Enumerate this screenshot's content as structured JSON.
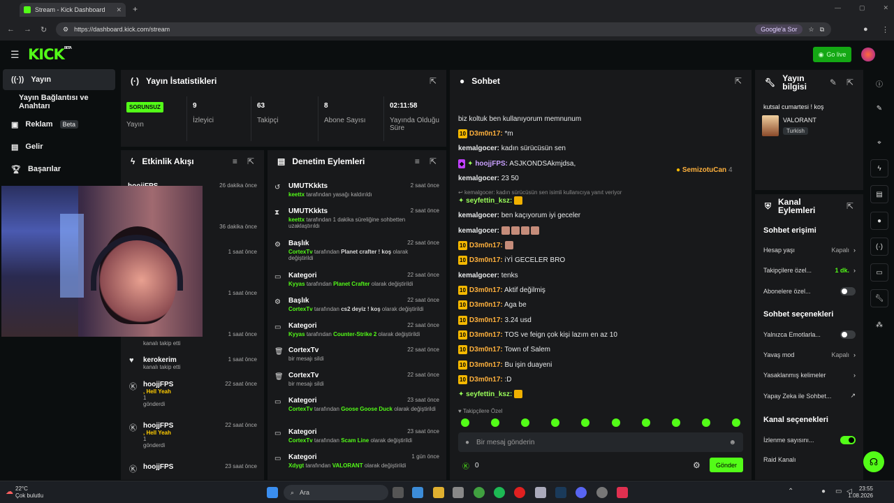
{
  "browser": {
    "tab_title": "Stream - Kick Dashboard",
    "url": "https://dashboard.kick.com/stream",
    "ask_google": "Google'a Sor"
  },
  "header": {
    "logo": "KICK",
    "beta": "BETA",
    "go_live": "Go live"
  },
  "sidebar": {
    "items": [
      {
        "label": "Yayın",
        "icon": "broadcast-icon"
      },
      {
        "label": "Yayın Bağlantısı ve Anahtarı",
        "icon": "key-icon"
      },
      {
        "label": "Reklam",
        "icon": "ad-icon",
        "badge": "Beta"
      },
      {
        "label": "Gelir",
        "icon": "chart-icon"
      },
      {
        "label": "Başarılar",
        "icon": "trophy-icon"
      }
    ]
  },
  "stats": {
    "title": "Yayın İstatistikleri",
    "status_badge": "SORUNSUZ",
    "status_label": "Yayın",
    "items": [
      {
        "value": "9",
        "label": "İzleyici"
      },
      {
        "value": "63",
        "label": "Takipçi"
      },
      {
        "value": "8",
        "label": "Abone Sayısı"
      },
      {
        "value": "02:11:58",
        "label": "Yayında Olduğu Süre"
      }
    ]
  },
  "feed": {
    "title": "Etkinlik Akışı",
    "items": [
      {
        "name": "hoojjFPS",
        "time": "26 dakika önce",
        "sub": ""
      },
      {
        "name": "",
        "time": "36 dakika önce",
        "sub": ""
      },
      {
        "name": "",
        "time": "1 saat önce",
        "sub": ""
      },
      {
        "name": "",
        "time": "1 saat önce",
        "sub": ""
      },
      {
        "name": "",
        "time": "1 saat önce",
        "sub": "kanalı takip etti"
      },
      {
        "name": "kerokerim",
        "time": "1 saat önce",
        "sub": "kanalı takip etti"
      },
      {
        "name": "hoojjFPS",
        "time": "22 saat önce",
        "sub": ", Hell Yeah",
        "extra": "1",
        "extra2": "gönderdi"
      },
      {
        "name": "hoojjFPS",
        "time": "22 saat önce",
        "sub": ", Hell Yeah",
        "extra": "1",
        "extra2": "gönderdi"
      },
      {
        "name": "hoojjFPS",
        "time": "23 saat önce",
        "sub": ""
      }
    ]
  },
  "mod": {
    "title": "Denetim Eylemleri",
    "items": [
      {
        "name": "UMUTKkkts",
        "time": "2 saat önce",
        "actor": "keettx",
        "text": "tarafından yasağı kaldırıldı",
        "icon": "undo-icon"
      },
      {
        "name": "UMUTKkkts",
        "time": "2 saat önce",
        "actor": "keettx",
        "text": "tarafından 1 dakika süreliğine sohbetten uzaklaştırıldı",
        "icon": "hourglass-icon"
      },
      {
        "name": "Başlık",
        "time": "22 saat önce",
        "actor": "CortexTv",
        "text": "tarafından",
        "value": "Planet crafter ! koş",
        "tail": "olarak değiştirildi",
        "icon": "title-icon"
      },
      {
        "name": "Kategori",
        "time": "22 saat önce",
        "actor": "Kyyas",
        "text": "tarafından",
        "value": "Planet Crafter",
        "tail": "olarak değiştirildi",
        "icon": "category-icon"
      },
      {
        "name": "Başlık",
        "time": "22 saat önce",
        "actor": "CortexTv",
        "text": "tarafından",
        "value": "cs2 deyiz ! koş",
        "tail": "olarak değiştirildi",
        "icon": "title-icon"
      },
      {
        "name": "Kategori",
        "time": "22 saat önce",
        "actor": "Kyyas",
        "text": "tarafından",
        "value": "Counter-Strike 2",
        "tail": "olarak değiştirildi",
        "icon": "category-icon"
      },
      {
        "name": "CortexTv",
        "time": "22 saat önce",
        "actor": "",
        "text": "bir mesajı sildi",
        "icon": "trash-icon"
      },
      {
        "name": "CortexTv",
        "time": "22 saat önce",
        "actor": "",
        "text": "bir mesajı sildi",
        "icon": "trash-icon"
      },
      {
        "name": "Kategori",
        "time": "23 saat önce",
        "actor": "CortexTv",
        "text": "tarafından",
        "value": "Goose Goose Duck",
        "tail": "olarak değiştirildi",
        "icon": "category-icon"
      },
      {
        "name": "Kategori",
        "time": "23 saat önce",
        "actor": "CortexTv",
        "text": "tarafından",
        "value": "Scam Line",
        "tail": "olarak değiştirildi",
        "icon": "category-icon"
      },
      {
        "name": "Kategori",
        "time": "1 gün önce",
        "actor": "Xdygt",
        "text": "tarafından",
        "value": "VALORANT",
        "tail": "olarak değiştirildi",
        "icon": "category-icon"
      }
    ]
  },
  "chat": {
    "title": "Sohbet",
    "pinned_user": "SemizotuCan",
    "pinned_count": "4",
    "messages": [
      {
        "user": "",
        "text": "biz koltuk ben kullanıyorum memnunum",
        "lvl": "",
        "style": "u"
      },
      {
        "user": "D3m0n17:",
        "text": "*m",
        "lvl": "10",
        "style": "u"
      },
      {
        "user": "kemalgocer:",
        "text": "kadın sürücüsün sen",
        "lvl": "",
        "style": "u2"
      },
      {
        "user": "hoojjFPS:",
        "text": "ASJKONDSAkmjdsa,",
        "lvl": "",
        "style": "u4"
      },
      {
        "user": "kemalgocer:",
        "text": "23 50",
        "lvl": "",
        "style": "u2"
      },
      {
        "user": "seyfettin_ksz:",
        "text": "",
        "lvl": "",
        "style": "u3"
      },
      {
        "user": "kemalgocer:",
        "text": "ben kaçıyorum iyi geceler",
        "lvl": "",
        "style": "u2"
      },
      {
        "user": "kemalgocer:",
        "text": "",
        "lvl": "",
        "style": "u2"
      },
      {
        "user": "D3m0n17:",
        "text": "",
        "lvl": "10",
        "style": "u"
      },
      {
        "user": "D3m0n17:",
        "text": "iYİ GECELER BRO",
        "lvl": "10",
        "style": "u"
      },
      {
        "user": "kemalgocer:",
        "text": "tenks",
        "lvl": "",
        "style": "u2"
      },
      {
        "user": "D3m0n17:",
        "text": "Aktif değilmiş",
        "lvl": "10",
        "style": "u"
      },
      {
        "user": "D3m0n17:",
        "text": "Aga be",
        "lvl": "10",
        "style": "u"
      },
      {
        "user": "D3m0n17:",
        "text": "3.24 usd",
        "lvl": "10",
        "style": "u"
      },
      {
        "user": "D3m0n17:",
        "text": "TOS ve feign çok kişi lazım en az 10",
        "lvl": "10",
        "style": "u"
      },
      {
        "user": "D3m0n17:",
        "text": "Town of Salem",
        "lvl": "10",
        "style": "u"
      },
      {
        "user": "D3m0n17:",
        "text": "Bu işin duayeni",
        "lvl": "10",
        "style": "u"
      },
      {
        "user": "D3m0n17:",
        "text": ":D",
        "lvl": "10",
        "style": "u"
      },
      {
        "user": "seyfettin_ksz:",
        "text": "",
        "lvl": "",
        "style": "u3"
      }
    ],
    "reply_note": "kemalgocer: kadın sürücüsün sen isimli kullanıcıya yanıt veriyor",
    "followers_only": "Takipçilere Özel",
    "placeholder": "Bir mesaj gönderin",
    "count": "0",
    "send": "Gönder"
  },
  "info": {
    "title": "Yayın bilgisi",
    "stream_title": "kutsal cumartesi ! koş",
    "category": "VALORANT",
    "language": "Turkish"
  },
  "actions": {
    "title": "Kanal Eylemleri",
    "access_h": "Sohbet erişimi",
    "rows1": [
      {
        "label": "Hesap yaşı",
        "value": "Kapalı"
      },
      {
        "label": "Takipçilere özel...",
        "value": "1 dk."
      },
      {
        "label": "Abonelere özel...",
        "value": ""
      }
    ],
    "options_h": "Sohbet seçenekleri",
    "rows2": [
      {
        "label": "Yalnızca Emotlarla...",
        "value": ""
      },
      {
        "label": "Yavaş mod",
        "value": "Kapalı"
      },
      {
        "label": "Yasaklanmış kelimeler",
        "value": ""
      },
      {
        "label": "Yapay Zeka ile Sohbet...",
        "value": ""
      }
    ],
    "channel_h": "Kanal seçenekleri",
    "rows3": [
      {
        "label": "İzlenme sayısını...",
        "value": ""
      },
      {
        "label": "Raid Kanalı",
        "value": ""
      }
    ]
  },
  "taskbar": {
    "temp": "22°C",
    "weather": "Çok bulutlu",
    "search": "Ara",
    "time": "23:55",
    "date": "1.08.2026"
  }
}
